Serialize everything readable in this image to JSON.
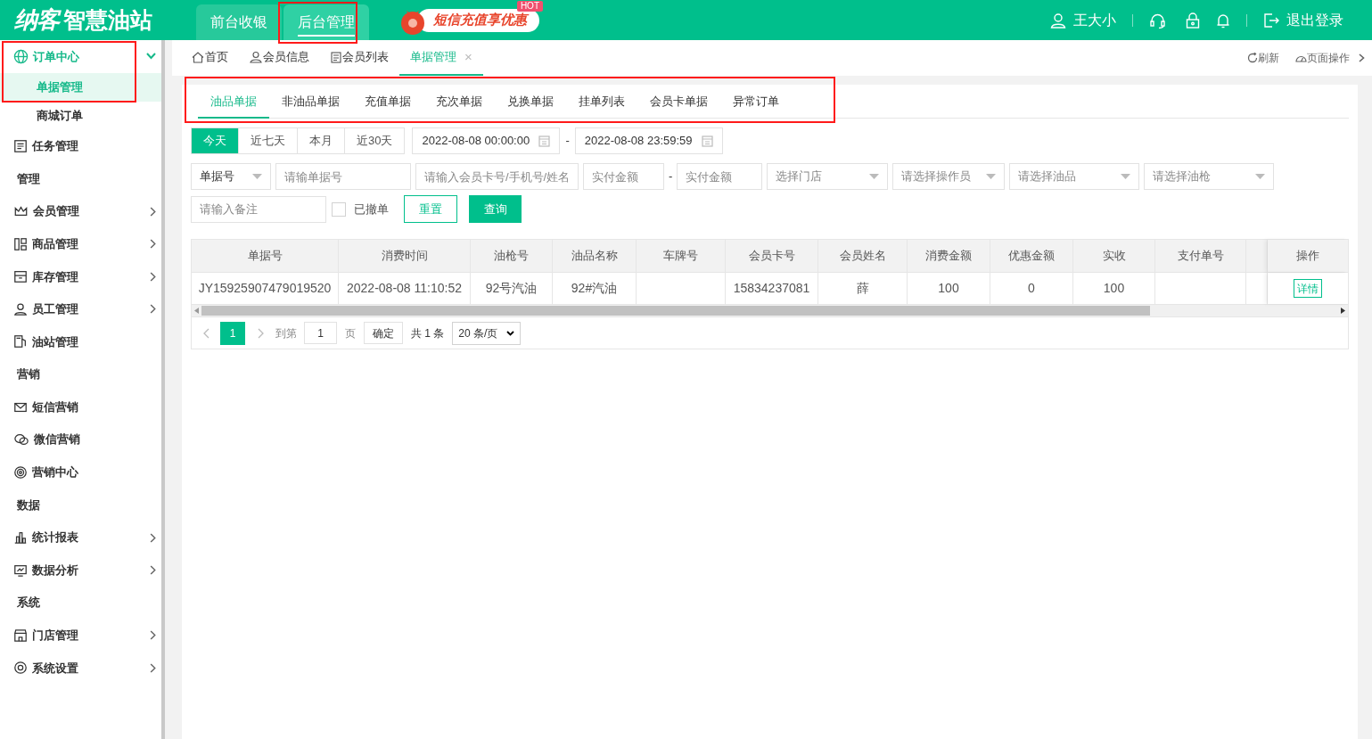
{
  "header": {
    "logo_brand": "纳客",
    "logo_text": "智慧油站",
    "nav": [
      {
        "label": "前台收银",
        "selected": false
      },
      {
        "label": "后台管理",
        "selected": true
      }
    ],
    "promo": {
      "text": "短信充值享优惠",
      "badge": "HOT"
    },
    "user": "王大小",
    "logout": "退出登录"
  },
  "sidebar": [
    {
      "kind": "group",
      "label": "订单中心",
      "expanded": true,
      "children": [
        {
          "label": "单据管理",
          "selected": true
        },
        {
          "label": "商城订单",
          "selected": false
        }
      ]
    },
    {
      "kind": "item",
      "label": "任务管理",
      "arrow": false
    },
    {
      "kind": "section",
      "label": "管理"
    },
    {
      "kind": "item",
      "label": "会员管理",
      "arrow": true
    },
    {
      "kind": "item",
      "label": "商品管理",
      "arrow": true
    },
    {
      "kind": "item",
      "label": "库存管理",
      "arrow": true
    },
    {
      "kind": "item",
      "label": "员工管理",
      "arrow": true
    },
    {
      "kind": "item",
      "label": "油站管理",
      "arrow": false
    },
    {
      "kind": "section",
      "label": "营销"
    },
    {
      "kind": "item",
      "label": "短信营销",
      "arrow": false
    },
    {
      "kind": "item",
      "label": "微信营销",
      "arrow": false
    },
    {
      "kind": "item",
      "label": "营销中心",
      "arrow": false
    },
    {
      "kind": "section",
      "label": "数据"
    },
    {
      "kind": "item",
      "label": "统计报表",
      "arrow": true
    },
    {
      "kind": "item",
      "label": "数据分析",
      "arrow": true
    },
    {
      "kind": "section",
      "label": "系统"
    },
    {
      "kind": "item",
      "label": "门店管理",
      "arrow": true
    },
    {
      "kind": "item",
      "label": "系统设置",
      "arrow": true
    }
  ],
  "page_tabs": [
    {
      "label": "首页",
      "selected": false,
      "closable": false
    },
    {
      "label": "会员信息",
      "selected": false,
      "closable": false
    },
    {
      "label": "会员列表",
      "selected": false,
      "closable": false
    },
    {
      "label": "单据管理",
      "selected": true,
      "closable": true
    }
  ],
  "page_tab_close": "×",
  "page_actions": [
    "刷新",
    "页面操作"
  ],
  "sub_tabs": [
    {
      "label": "油品单据",
      "selected": true
    },
    {
      "label": "非油品单据",
      "selected": false
    },
    {
      "label": "充值单据",
      "selected": false
    },
    {
      "label": "充次单据",
      "selected": false
    },
    {
      "label": "兑换单据",
      "selected": false
    },
    {
      "label": "挂单列表",
      "selected": false
    },
    {
      "label": "会员卡单据",
      "selected": false
    },
    {
      "label": "异常订单",
      "selected": false
    }
  ],
  "date_ranges": [
    {
      "label": "今天",
      "selected": true
    },
    {
      "label": "近七天",
      "selected": false
    },
    {
      "label": "本月",
      "selected": false
    },
    {
      "label": "近30天",
      "selected": false
    }
  ],
  "date_start": "2022-08-08 00:00:00",
  "date_end": "2022-08-08 23:59:59",
  "range_separator": "-",
  "filters": {
    "search_type": "单据号",
    "order_no_placeholder": "请输单据号",
    "member_placeholder": "请输入会员卡号/手机号/姓名",
    "amount_min_placeholder": "实付金额",
    "amount_max_placeholder": "实付金额",
    "selects": [
      "选择门店",
      "请选择操作员",
      "请选择油品",
      "请选择油枪"
    ],
    "remark_placeholder": "请输入备注",
    "revoked": {
      "label": "已撤单",
      "checked": false
    },
    "reset": "重置",
    "query": "查询"
  },
  "table": {
    "columns": [
      "单据号",
      "消费时间",
      "油枪号",
      "油品名称",
      "车牌号",
      "会员卡号",
      "会员姓名",
      "消费金额",
      "优惠金额",
      "实收",
      "支付单号",
      "操作"
    ],
    "rows": [
      {
        "cells": [
          "JY15925907479019520",
          "2022-08-08 11:10:52",
          "92号汽油",
          "92#汽油",
          "",
          "15834237081",
          "薛",
          "100",
          "0",
          "100",
          ""
        ],
        "action": "详情"
      }
    ]
  },
  "pagination": {
    "current": "1",
    "goto_label": "到第",
    "goto_value": "1",
    "page_unit": "页",
    "confirm": "确定",
    "total": "共 1 条",
    "page_size": "20 条/页"
  }
}
